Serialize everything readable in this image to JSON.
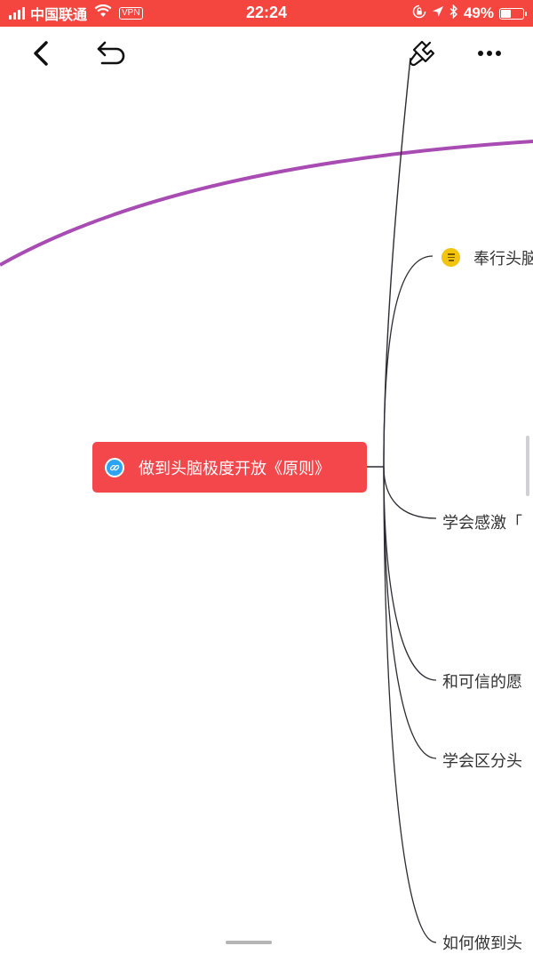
{
  "status_bar": {
    "carrier": "中国联通",
    "vpn": "VPN",
    "time": "22:24",
    "battery_percent": "49%",
    "battery_level": 0.49,
    "signal_bars": 4
  },
  "toolbar": {
    "back_icon": "chevron-left-icon",
    "undo_icon": "undo-icon",
    "style_icon": "paintbrush-icon",
    "more_icon": "more-horizontal-icon"
  },
  "mindmap": {
    "central_topic": "做到头脑极度开放《原则》",
    "central_icon": "link-icon",
    "central_color": "#f4474b",
    "branch_color": "#a84bb2",
    "children": [
      {
        "label": "奉行头脑",
        "has_note": true,
        "note_icon": "note-icon"
      },
      {
        "label": "学会感激「"
      },
      {
        "label": "和可信的愿"
      },
      {
        "label": "学会区分头"
      },
      {
        "label": "如何做到头"
      }
    ]
  }
}
